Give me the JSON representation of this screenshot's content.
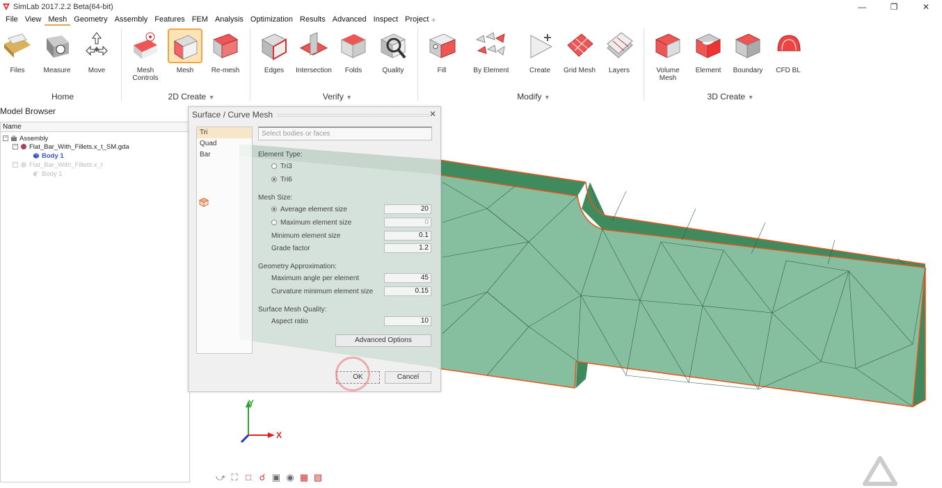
{
  "window": {
    "title": "SimLab 2017.2.2 Beta(64-bit)"
  },
  "menu": [
    "File",
    "View",
    "Mesh",
    "Geometry",
    "Assembly",
    "Features",
    "FEM",
    "Analysis",
    "Optimization",
    "Results",
    "Advanced",
    "Inspect",
    "Project"
  ],
  "ribbon": {
    "buttons": {
      "files": "Files",
      "measure": "Measure",
      "move": "Move",
      "mesh_controls": "Mesh\nControls",
      "mesh": "Mesh",
      "remesh": "Re-mesh",
      "edges": "Edges",
      "intersection": "Intersection",
      "folds": "Folds",
      "quality": "Quality",
      "fill": "Fill",
      "by_element": "By Element",
      "create": "Create",
      "grid_mesh": "Grid Mesh",
      "layers": "Layers",
      "volume_mesh": "Volume\nMesh",
      "element": "Element",
      "boundary": "Boundary",
      "cfd_bl": "CFD BL"
    },
    "groups": {
      "home": "Home",
      "create2d": "2D Create",
      "verify": "Verify",
      "modify": "Modify",
      "create3d": "3D Create"
    }
  },
  "model_browser": {
    "title": "Model Browser",
    "column": "Name",
    "rows": {
      "assembly": "Assembly",
      "part1": "Flat_Bar_With_Fillets.x_t_SM.gda",
      "body1": "Body 1",
      "part2": "Flat_Bar_With_Fillets.x_t",
      "body2": "Body 1"
    }
  },
  "dialog": {
    "title": "Surface / Curve Mesh",
    "types": [
      "Tri",
      "Quad",
      "Bar"
    ],
    "select_placeholder": "Select bodies or faces",
    "element_type_label": "Element Type:",
    "tri3": "Tri3",
    "tri6": "Tri6",
    "mesh_size_label": "Mesh Size:",
    "avg_size_label": "Average element size",
    "avg_size_value": "20",
    "max_size_label": "Maximum element size",
    "max_size_value": "0",
    "min_size_label": "Minimum element size",
    "min_size_value": "0.1",
    "grade_label": "Grade factor",
    "grade_value": "1.2",
    "geo_approx_label": "Geometry Approximation:",
    "max_angle_label": "Maximum angle per element",
    "max_angle_value": "45",
    "curv_min_label": "Curvature minimum element size",
    "curv_min_value": "0.15",
    "quality_label": "Surface Mesh Quality:",
    "aspect_label": "Aspect ratio",
    "aspect_value": "10",
    "advanced_button": "Advanced Options",
    "ok_button": "OK",
    "cancel_button": "Cancel"
  },
  "axes": {
    "y": "Y",
    "x": "X"
  },
  "colors": {
    "mesh_fill": "#86bf9f",
    "mesh_side": "#3e8a5e",
    "edge": "#e8541c",
    "accent": "#f0a640"
  }
}
